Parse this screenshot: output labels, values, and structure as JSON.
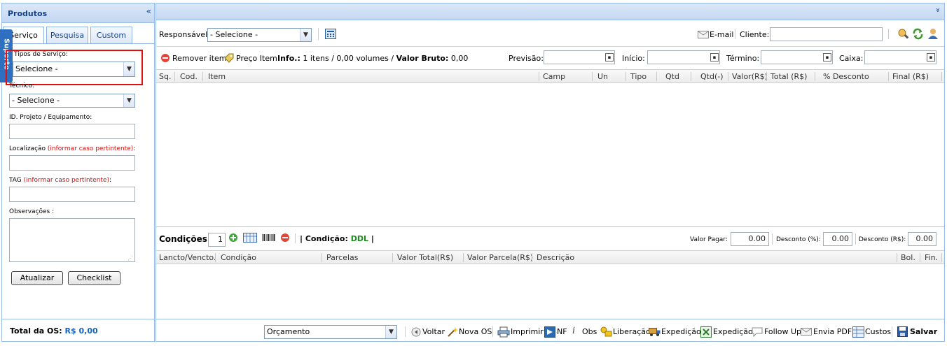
{
  "left_panel": {
    "title": "Produtos",
    "collapse_glyph": "«",
    "side_tab": "Suporte",
    "tabs": [
      "Serviço",
      "Pesquisa",
      "Custom"
    ],
    "tipos_label": "Tipos de Serviço:",
    "tipos_value": "Selecione -",
    "tecnico_label": "Técnico:",
    "tecnico_value": "- Selecione -",
    "projeto_label": "ID. Projeto / Equipamento:",
    "localizacao_label": "Localização",
    "localizacao_hint": "(informar caso pertintente)",
    "tag_label": "TAG",
    "tag_hint": "(informar caso pertintente)",
    "obs_label": "Observações :",
    "atualizar_label": "Atualizar",
    "checklist_label": "Checklist"
  },
  "toolbar": {
    "responsavel_label": "Responsável:",
    "responsavel_value": "- Selecione -",
    "email_label": "E-mail",
    "cliente_label": "Cliente:",
    "remover_label": "Remover item",
    "preco_label": "Preço Item",
    "info_label": "Info.:",
    "info_value": "1 itens / 0,00 volumes /",
    "valor_bruto_label": "Valor Bruto:",
    "valor_bruto_value": "0,00",
    "previsao_label": "Previsão:",
    "inicio_label": "Início:",
    "termino_label": "Término:",
    "caixa_label": "Caixa:"
  },
  "items_grid": {
    "columns": [
      "Sq.",
      "Cod.",
      "Item",
      "Camp",
      "Un",
      "Tipo",
      "Qtd",
      "Qtd(-)",
      "Valor(R$)",
      "Total (R$)",
      "% Desconto",
      "Final (R$)"
    ]
  },
  "conditions": {
    "label": "Condições:",
    "count": "1",
    "condicao_label": "| Condição:",
    "condicao_value": "DDL",
    "condicao_end": "|",
    "valor_pagar_label": "Valor Pagar:",
    "valor_pagar": "0.00",
    "desconto_pct_label": "Desconto (%):",
    "desconto_pct": "0.00",
    "desconto_rs_label": "Desconto (R$):",
    "desconto_rs": "0.00",
    "columns": [
      "Lancto/Vencto.",
      "Condição",
      "Parcelas",
      "Valor Total(R$)",
      "Valor Parcela(R$)",
      "Descrição",
      "Bol.",
      "Fin."
    ]
  },
  "footer": {
    "total_label": "Total da OS:",
    "total_value": "R$ 0,00",
    "status_value": "Orçamento",
    "actions": [
      "Voltar",
      "Nova OS",
      "Imprimir",
      "NF",
      "Obs",
      "Liberação",
      "Expedição",
      "Expedição",
      "Follow Up",
      "Envia PDF",
      "Custos",
      "Salvar"
    ]
  },
  "colors": {
    "accent_blue": "#15428b",
    "header_bg": "#c4d8f1",
    "highlight_red": "#e01010",
    "ddl_green": "#1a8c1a",
    "total_blue": "#1565c0"
  }
}
